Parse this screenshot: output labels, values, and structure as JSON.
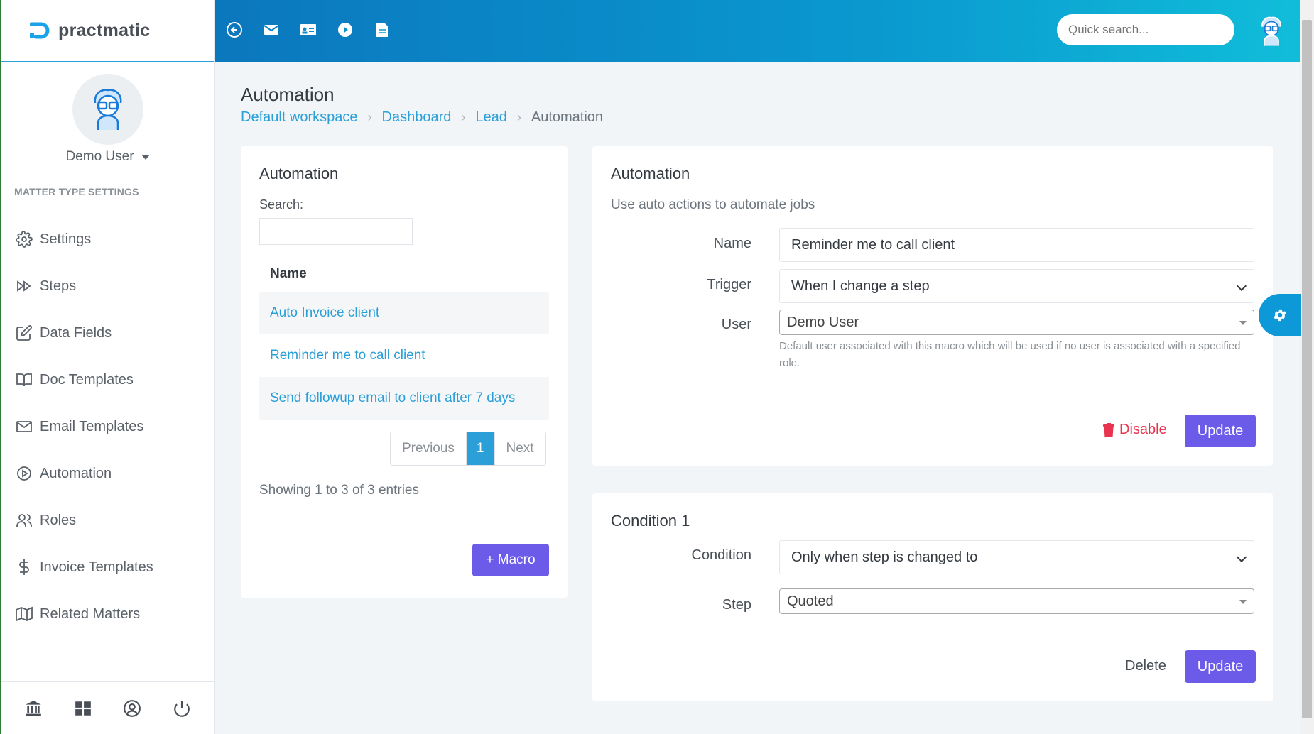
{
  "app": {
    "name": "practmatic"
  },
  "colors": {
    "primary": "#2a9fd8",
    "button": "#6c5ae8",
    "danger": "#e8344e",
    "topbar_start": "#0b77bd",
    "topbar_end": "#10bdd9"
  },
  "sidebar": {
    "user_name": "Demo User",
    "section_label": "MATTER TYPE SETTINGS",
    "items": [
      {
        "label": "Settings",
        "icon": "gear-icon"
      },
      {
        "label": "Steps",
        "icon": "fast-forward-icon"
      },
      {
        "label": "Data Fields",
        "icon": "edit-icon"
      },
      {
        "label": "Doc Templates",
        "icon": "book-icon"
      },
      {
        "label": "Email Templates",
        "icon": "mail-icon"
      },
      {
        "label": "Automation",
        "icon": "play-circle-icon"
      },
      {
        "label": "Roles",
        "icon": "users-icon"
      },
      {
        "label": "Invoice Templates",
        "icon": "dollar-icon"
      },
      {
        "label": "Related Matters",
        "icon": "map-icon"
      }
    ],
    "footer_icons": [
      "bank-icon",
      "grid-icon",
      "user-circle-icon",
      "power-icon"
    ]
  },
  "topbar": {
    "icons": [
      "back-circle-icon",
      "mail-icon",
      "contact-card-icon",
      "play-icon",
      "document-icon"
    ],
    "search_placeholder": "Quick search..."
  },
  "page": {
    "title": "Automation",
    "breadcrumb": [
      "Default workspace",
      "Dashboard",
      "Lead",
      "Automation"
    ]
  },
  "list_card": {
    "title": "Automation",
    "search_label": "Search:",
    "column": "Name",
    "rows": [
      "Auto Invoice client",
      "Reminder me to call client",
      "Send followup email to client after 7 days"
    ],
    "pagination": {
      "previous": "Previous",
      "current": "1",
      "next": "Next"
    },
    "showing": "Showing 1 to 3 of 3 entries",
    "add_button": "+ Macro"
  },
  "automation_form": {
    "title": "Automation",
    "subtitle": "Use auto actions to automate jobs",
    "name_label": "Name",
    "name_value": "Reminder me to call client",
    "trigger_label": "Trigger",
    "trigger_value": "When I change a step",
    "user_label": "User",
    "user_value": "Demo User",
    "user_help": "Default user associated with this macro which will be used if no user is associated with a specified role.",
    "disable_label": "Disable",
    "update_label": "Update"
  },
  "condition_form": {
    "title": "Condition 1",
    "condition_label": "Condition",
    "condition_value": "Only when step is changed to",
    "step_label": "Step",
    "step_value": "Quoted",
    "delete_label": "Delete",
    "update_label": "Update"
  }
}
